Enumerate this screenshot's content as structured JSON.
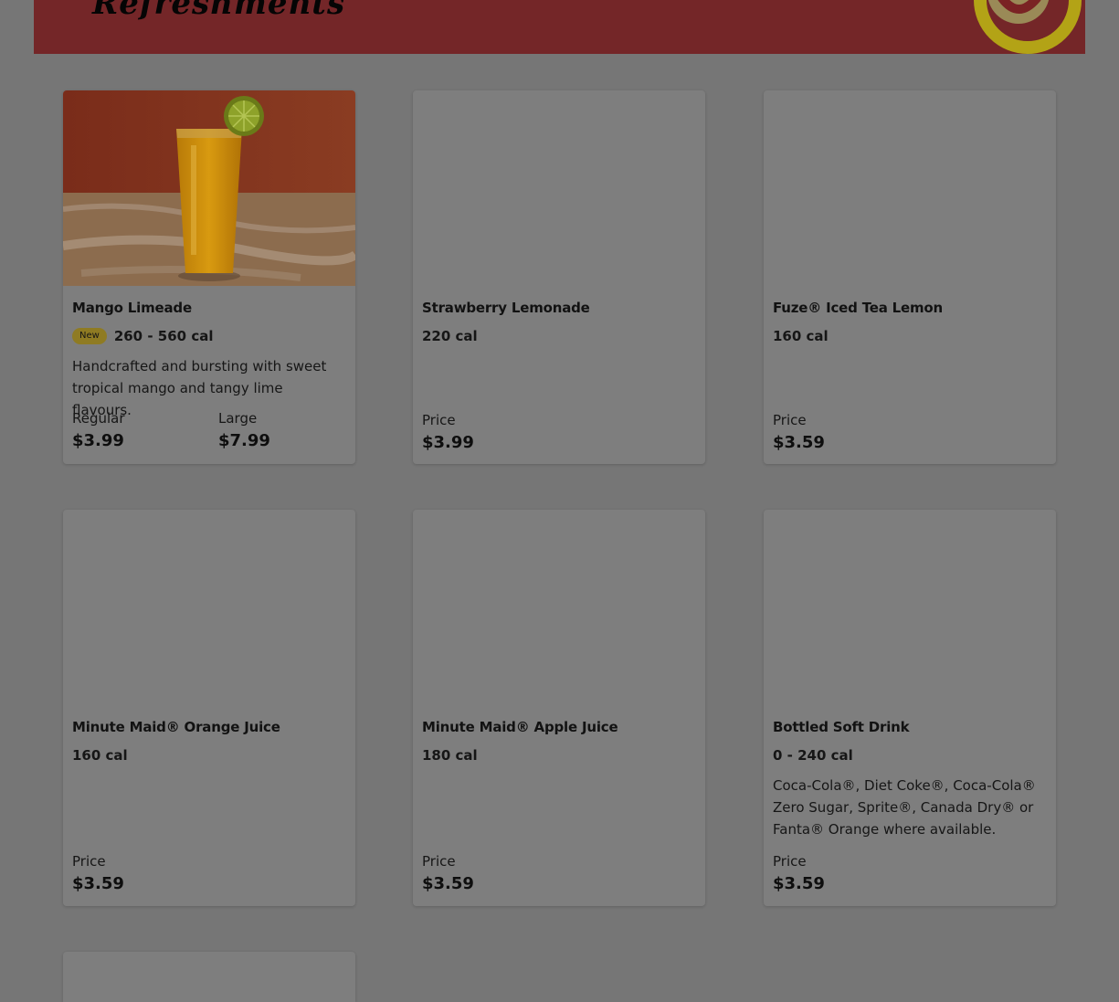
{
  "header": {
    "title": "Refreshments"
  },
  "colors": {
    "banner": "#742628",
    "background": "#767676",
    "card": "#7e7e7e",
    "badge": "#8f7b23",
    "decoration": "#b3a316"
  },
  "items": [
    {
      "name": "Mango Limeade",
      "badge": "New",
      "calories": "260 - 560 cal",
      "description": "Handcrafted and bursting with sweet tropical mango and tangy lime flavours.",
      "prices": [
        {
          "label": "Regular",
          "value": "$3.99"
        },
        {
          "label": "Large",
          "value": "$7.99"
        }
      ]
    },
    {
      "name": "Strawberry Lemonade",
      "calories": "220 cal",
      "prices": [
        {
          "label": "Price",
          "value": "$3.99"
        }
      ]
    },
    {
      "name": "Fuze® Iced Tea Lemon",
      "calories": "160 cal",
      "prices": [
        {
          "label": "Price",
          "value": "$3.59"
        }
      ]
    },
    {
      "name": "Minute Maid® Orange Juice",
      "calories": "160 cal",
      "prices": [
        {
          "label": "Price",
          "value": "$3.59"
        }
      ]
    },
    {
      "name": "Minute Maid® Apple Juice",
      "calories": "180 cal",
      "prices": [
        {
          "label": "Price",
          "value": "$3.59"
        }
      ]
    },
    {
      "name": "Bottled Soft Drink",
      "calories": "0 - 240 cal",
      "description": "Coca-Cola®, Diet Coke®, Coca-Cola® Zero Sugar, Sprite®, Canada Dry® or Fanta® Orange where available.",
      "prices": [
        {
          "label": "Price",
          "value": "$3.59"
        }
      ]
    }
  ]
}
